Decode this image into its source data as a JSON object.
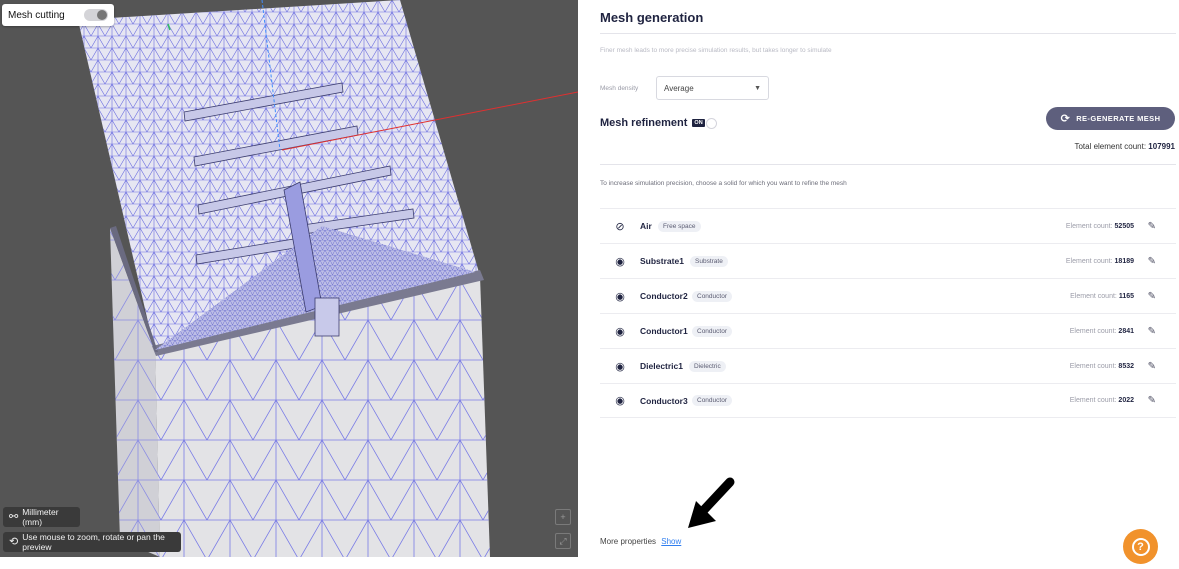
{
  "viewport": {
    "mesh_cutting_label": "Mesh cutting",
    "unit_label": "Millimeter (mm)",
    "hint_label": "Use mouse to zoom, rotate or pan the preview",
    "mesh_color": "#6d6fe0",
    "background_color": "#555555"
  },
  "panel": {
    "title": "Mesh generation",
    "description": "Finer mesh leads to more precise simulation results, but takes longer to simulate",
    "density_label": "Mesh density",
    "density_value": "Average",
    "refinement_label": "Mesh refinement",
    "refinement_toggle": "ON",
    "regen_button": "RE-GENERATE MESH",
    "total_label": "Total element count:",
    "total_value": "107991",
    "instruction": "To increase simulation precision, choose a solid for which you want to refine the mesh",
    "count_label": "Element count:",
    "solids": [
      {
        "name": "Air",
        "tag": "Free space",
        "count": "52505",
        "visible": false
      },
      {
        "name": "Substrate1",
        "tag": "Substrate",
        "count": "18189",
        "visible": true
      },
      {
        "name": "Conductor2",
        "tag": "Conductor",
        "count": "1165",
        "visible": true
      },
      {
        "name": "Conductor1",
        "tag": "Conductor",
        "count": "2841",
        "visible": true
      },
      {
        "name": "Dielectric1",
        "tag": "Dielectric",
        "count": "8532",
        "visible": true
      },
      {
        "name": "Conductor3",
        "tag": "Conductor",
        "count": "2022",
        "visible": true
      }
    ],
    "more_label": "More properties",
    "show_link": "Show",
    "accent_color": "#5e5f7d",
    "help_color": "#f1922c"
  }
}
